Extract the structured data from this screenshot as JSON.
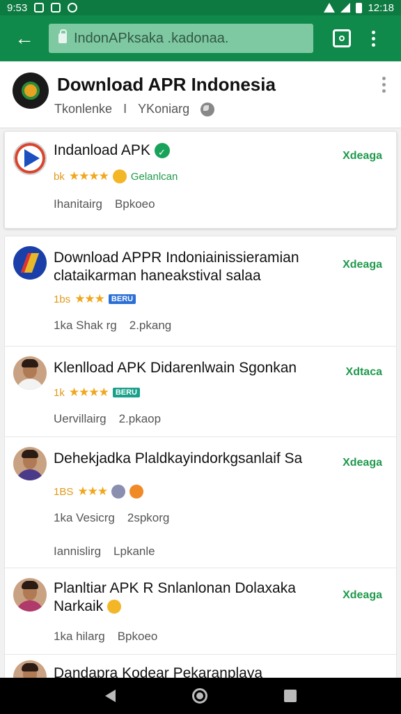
{
  "status_bar": {
    "time_left": "9:53",
    "time_right": "12:18"
  },
  "toolbar": {
    "url": "IndonAPksaka .kadonaa."
  },
  "page_header": {
    "title": "Download APR Indonesia",
    "subtitle_a": "Tkonlenke",
    "subtitle_sep": "I",
    "subtitle_b": "YKoniarg"
  },
  "items": [
    {
      "title": "Indanload APK",
      "rating": "bk",
      "tag": "Gelanlcan",
      "meta_a": "Ihanitairg",
      "meta_b": "Bpkoeo",
      "action": "Xdeaga"
    },
    {
      "title": "Download APPR Indoniainissieramian clataikarman haneakstival salaa",
      "rating": "1bs",
      "badge": "BERU",
      "meta_a": "1ka Shak rg",
      "meta_b": "2.pkang",
      "action": "Xdeaga"
    },
    {
      "title": "Klenlload APK Didarenlwain Sgonkan",
      "rating": "1k",
      "badge": "BERU",
      "meta_a": "Uervillairg",
      "meta_b": "2.pkaop",
      "action": "Xdtaca"
    },
    {
      "title": "Dehekjadka Plaldkayindorkgsanlaif Sa",
      "rating": "1BS",
      "meta_a": "1ka Vesicrg",
      "meta_b": "2spkorg",
      "meta_c": "Iannislirg",
      "meta_d": "Lpkanle",
      "action": "Xdeaga"
    },
    {
      "title": "Planltiar APK R Snlanlonan Dolaxaka Narkaik",
      "meta_a": "1ka hilarg",
      "meta_b": "Bpkoeo",
      "action": "Xdeaga"
    },
    {
      "title": "Dandapra Kodear Pekaranplaya"
    }
  ],
  "colors": {
    "toolbar": "#0f8a4a",
    "status_bar": "#0d7a42",
    "accent_green": "#1f9a4c",
    "star": "#f0a71c"
  }
}
